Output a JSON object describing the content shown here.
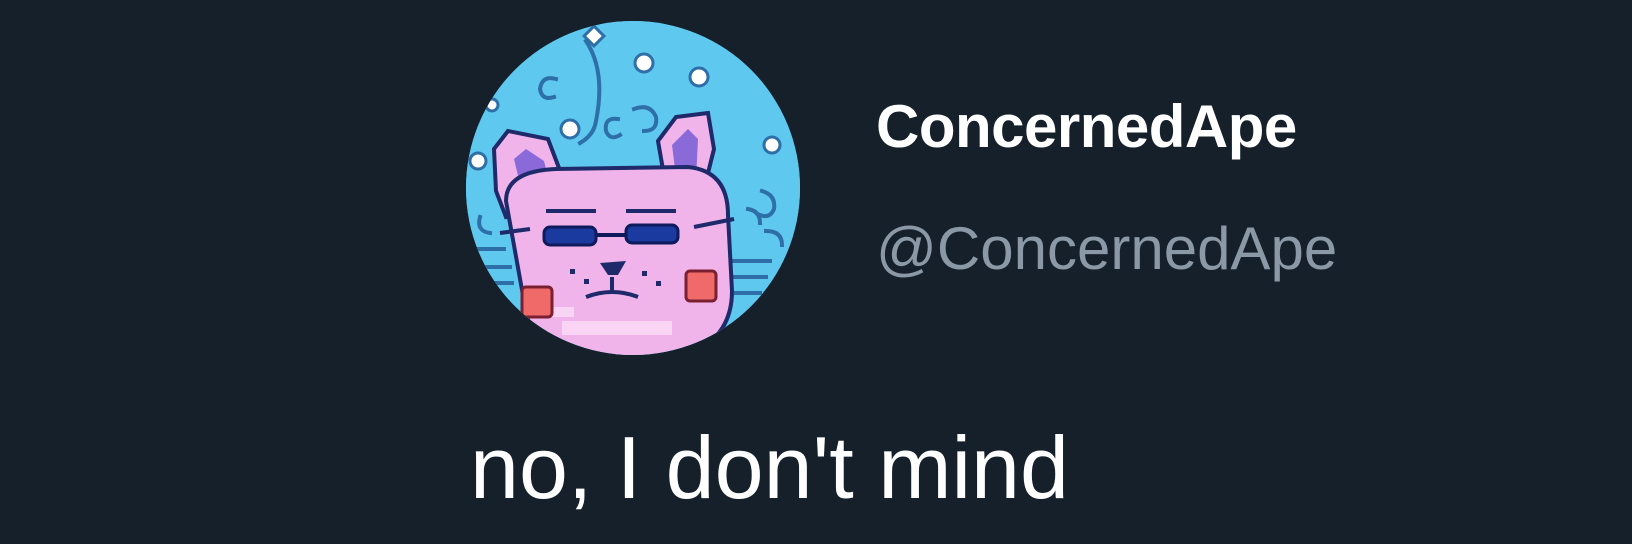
{
  "tweet": {
    "author": {
      "display_name": "ConcernedApe",
      "handle": "@ConcernedApe",
      "avatar_icon": "pixel-art-cat-avatar"
    },
    "text": "no, I don't mind"
  },
  "colors": {
    "background": "#15202b",
    "display_name": "#ffffff",
    "handle": "#8b98a5",
    "text": "#ffffff",
    "avatar_background": "#5ec8ef"
  }
}
